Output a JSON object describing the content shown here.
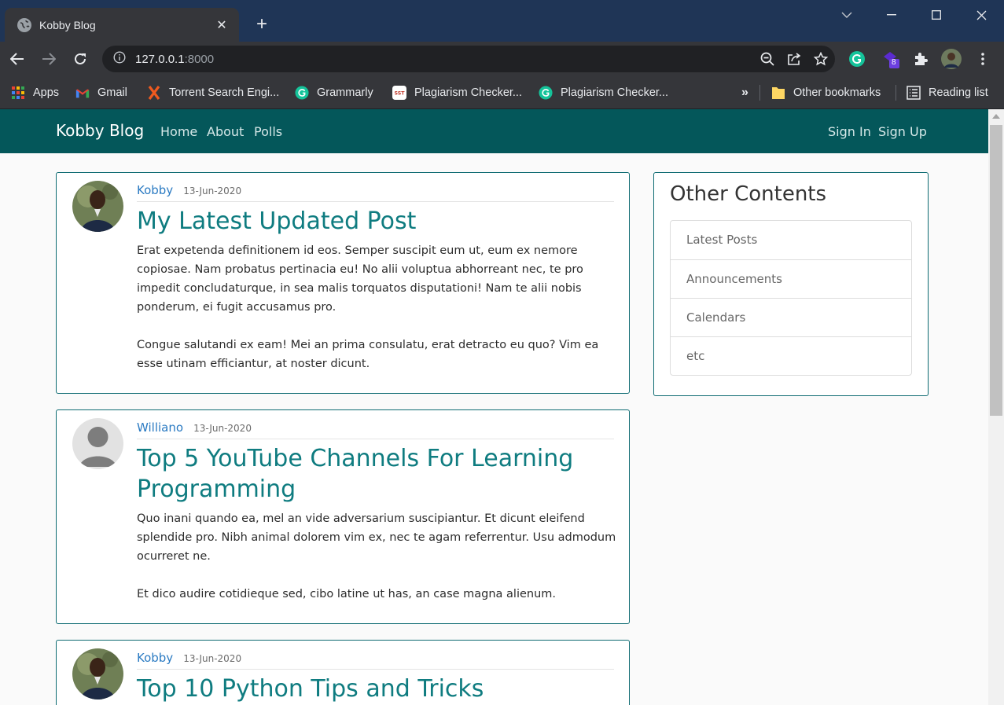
{
  "browser": {
    "tab_title": "Kobby Blog",
    "url_host": "127.0.0.1",
    "url_port": ":8000",
    "extension_badge": "8",
    "bookmarks": [
      {
        "label": "Apps",
        "icon": "apps-grid-icon"
      },
      {
        "label": "Gmail",
        "icon": "gmail-icon"
      },
      {
        "label": "Torrent Search Engi...",
        "icon": "torrent-x-icon"
      },
      {
        "label": "Grammarly",
        "icon": "grammarly-icon"
      },
      {
        "label": "Plagiarism Checker...",
        "icon": "sst-icon"
      },
      {
        "label": "Plagiarism Checker...",
        "icon": "grammarly-icon"
      }
    ],
    "overflow_label": "»",
    "other_bookmarks": "Other bookmarks",
    "reading_list": "Reading list"
  },
  "site": {
    "brand": "Kobby Blog",
    "nav": [
      "Home",
      "About",
      "Polls"
    ],
    "auth": [
      "Sign In",
      "Sign Up"
    ],
    "accent_color": "#04575a"
  },
  "posts": [
    {
      "author": "Kobby",
      "date": "13-Jun-2020",
      "title": "My Latest Updated Post",
      "paragraphs": [
        "Erat expetenda definitionem id eos. Semper suscipit eum ut, eum ex nemore copiosae. Nam probatus pertinacia eu! No alii voluptua abhorreant nec, te pro impedit concludaturque, in sea malis torquatos disputationi! Nam te alii nobis ponderum, ei fugit accusamus pro.",
        "Congue salutandi ex eam! Mei an prima consulatu, erat detracto eu quo? Vim ea esse utinam efficiantur, at noster dicunt."
      ]
    },
    {
      "author": "Williano",
      "date": "13-Jun-2020",
      "title": "Top 5 YouTube Channels For Learning Programming",
      "paragraphs": [
        "Quo inani quando ea, mel an vide adversarium suscipiantur. Et dicunt eleifend splendide pro. Nibh animal dolorem vim ex, nec te agam referrentur. Usu admodum ocurreret ne.",
        "Et dico audire cotidieque sed, cibo latine ut has, an case magna alienum."
      ]
    },
    {
      "author": "Kobby",
      "date": "13-Jun-2020",
      "title": "Top 10 Python Tips and Tricks",
      "paragraphs": []
    }
  ],
  "sidebar": {
    "title": "Other Contents",
    "items": [
      "Latest Posts",
      "Announcements",
      "Calendars",
      "etc"
    ]
  }
}
